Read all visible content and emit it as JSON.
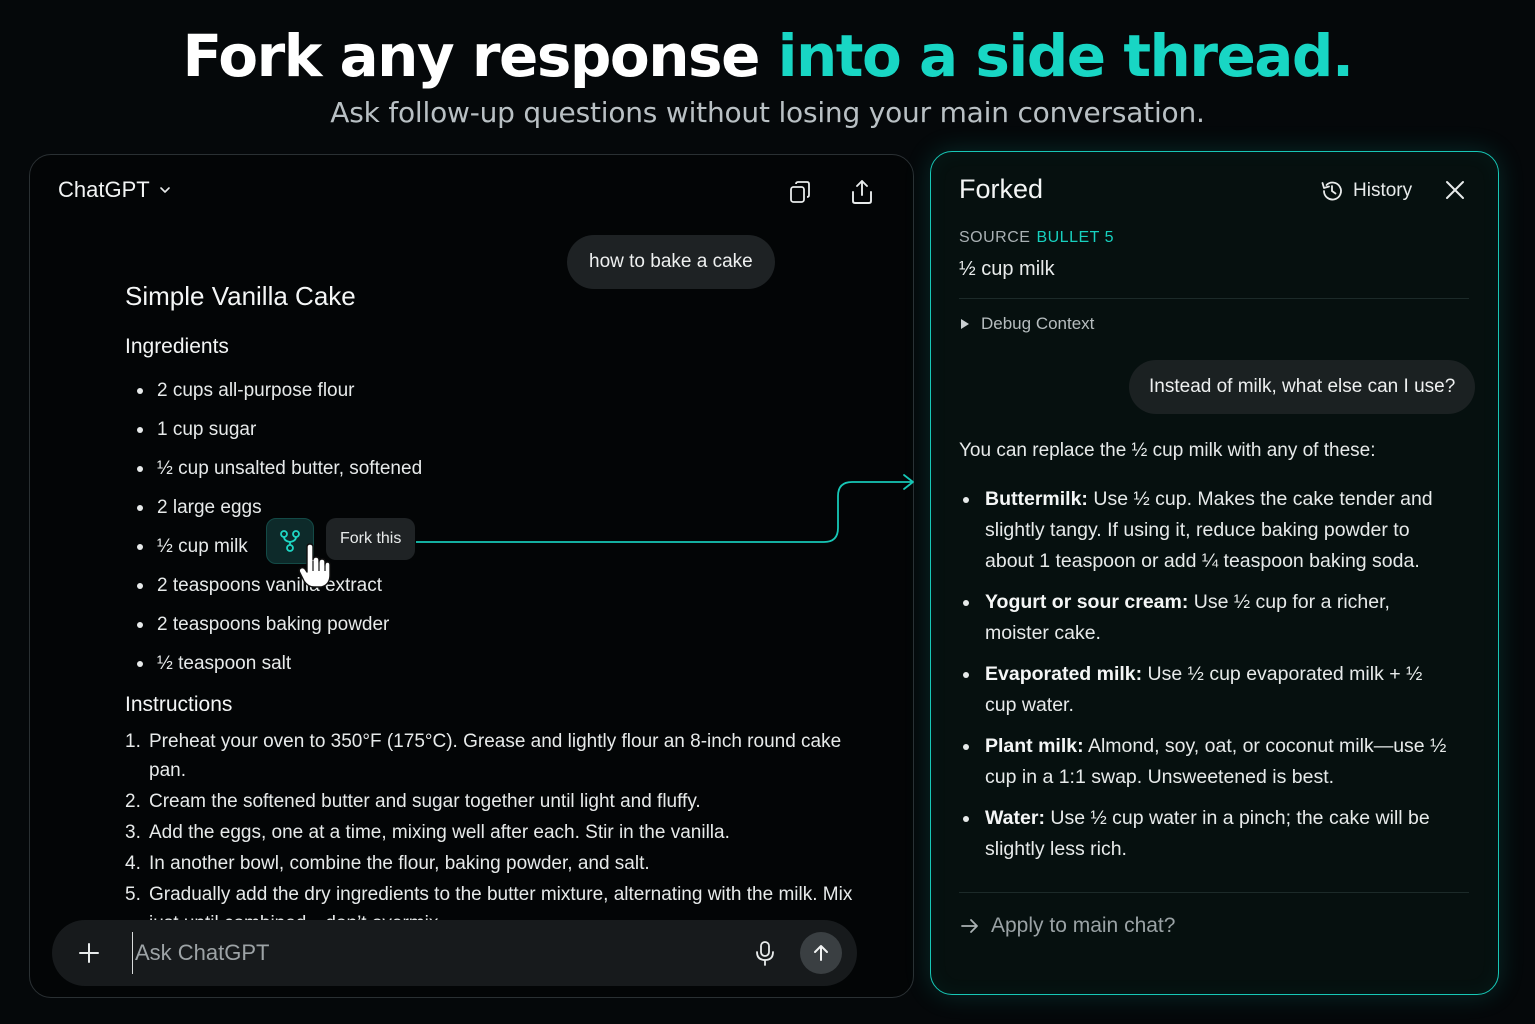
{
  "hero": {
    "title_main": "Fork any response ",
    "title_accent": "into a side thread.",
    "subtitle": "Ask follow-up questions without losing your main conversation."
  },
  "chat": {
    "app_title": "ChatGPT",
    "icons": [
      "chevron-down-icon",
      "copy-icon",
      "share-icon"
    ],
    "user_message": "how to bake a cake",
    "response": {
      "title": "Simple Vanilla Cake",
      "ingredients_heading": "Ingredients",
      "ingredients": [
        "2 cups all-purpose flour",
        "1 cup sugar",
        "½ cup unsalted butter, softened",
        "2 large eggs",
        "½ cup milk",
        "2 teaspoons vanilla extract",
        "2 teaspoons baking powder",
        "½ teaspoon salt"
      ],
      "instructions_heading": "Instructions",
      "instructions": [
        {
          "num": "1.",
          "text": "Preheat your oven to 350°F (175°C). Grease and lightly flour an 8-inch round cake pan."
        },
        {
          "num": "2.",
          "text": "Cream the softened butter and sugar together until light and fluffy."
        },
        {
          "num": "3.",
          "text": "Add the eggs, one at a time, mixing well after each. Stir in the vanilla."
        },
        {
          "num": "4.",
          "text": "In another bowl, combine the flour, baking powder, and salt."
        },
        {
          "num": "5.",
          "text": "Gradually add the dry ingredients to the butter mixture, alternating with the milk. Mix just until combined—don’t overmix."
        }
      ]
    },
    "fork_tooltip": "Fork this",
    "composer": {
      "placeholder": "Ask ChatGPT",
      "icons": [
        "plus-icon",
        "microphone-icon",
        "arrow-up-icon"
      ]
    }
  },
  "fork_panel": {
    "title": "Forked",
    "history_label": "History",
    "source_label": "SOURCE",
    "source_value": "BULLET 5",
    "source_quote": "½ cup milk",
    "debug_label": "Debug Context",
    "user_message": "Instead of milk, what else can I use?",
    "intro": "You can replace the ½ cup milk with any of these:",
    "options": [
      {
        "term": "Buttermilk:",
        "text": " Use ½ cup. Makes the cake tender and slightly tangy. If using it, reduce baking powder to about 1 teaspoon or add ¼ teaspoon baking soda."
      },
      {
        "term": "Yogurt or sour cream:",
        "text": " Use ½ cup for a richer, moister cake."
      },
      {
        "term": "Evaporated milk:",
        "text": " Use ½ cup evaporated milk + ½ cup water."
      },
      {
        "term": "Plant milk:",
        "text": " Almond, soy, oat, or coconut milk—use ½ cup in a 1:1 swap. Unsweetened is best."
      },
      {
        "term": "Water:",
        "text": " Use ½ cup water in a pinch; the cake will be slightly less rich."
      }
    ],
    "apply_label": "Apply to main chat?"
  },
  "colors": {
    "accent": "#18d6c4",
    "background": "#05080a"
  }
}
